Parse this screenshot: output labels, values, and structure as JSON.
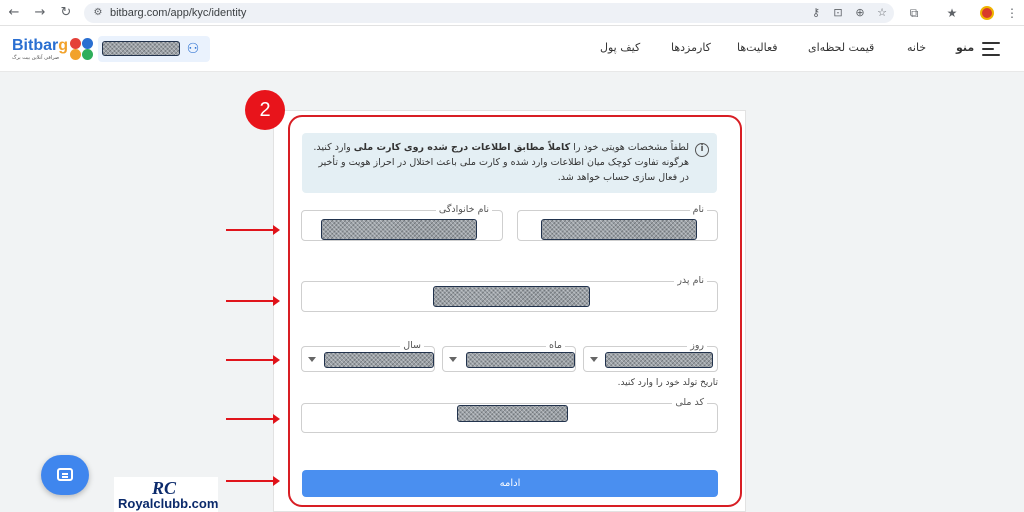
{
  "browser": {
    "url": "bitbarg.com/app/kyc/identity",
    "back_icon": "arrow-left-icon",
    "forward_icon": "arrow-right-icon",
    "reload_icon": "reload-icon"
  },
  "header": {
    "logo_main": "Bitbar",
    "logo_g": "g",
    "logo_sub": "صرافی آنلاین بیت برگ",
    "menu_label": "منو",
    "nav": [
      "خانه",
      "قیمت لحظه‌ای",
      "فعالیت‌ها",
      "کارمزدها",
      "کیف پول"
    ]
  },
  "step": {
    "number": "2"
  },
  "info": {
    "before": "لطفاً مشخصات هویتی خود را ",
    "bold": "کاملاً مطابق اطلاعات درج شده روی کارت ملی",
    "after": " وارد کنید.",
    "line2": "هرگونه تفاوت کوچک میان اطلاعات وارد شده و کارت ملی باعث اختلال در احراز هویت و تأخیر در فعال سازی حساب خواهد شد."
  },
  "form": {
    "first_name_label": "نام",
    "last_name_label": "نام خانوادگی",
    "father_name_label": "نام پدر",
    "day_label": "روز",
    "month_label": "ماه",
    "year_label": "سال",
    "birth_hint": "تاریخ تولد خود را وارد کنید.",
    "national_code_label": "کد ملی",
    "submit_label": "ادامه"
  },
  "watermark": {
    "mark": "RC",
    "text": "Royalclubb.com"
  },
  "colors": {
    "accent": "#4a8ff0",
    "annotation": "#e0141b",
    "info_bg": "#e4eff4"
  }
}
